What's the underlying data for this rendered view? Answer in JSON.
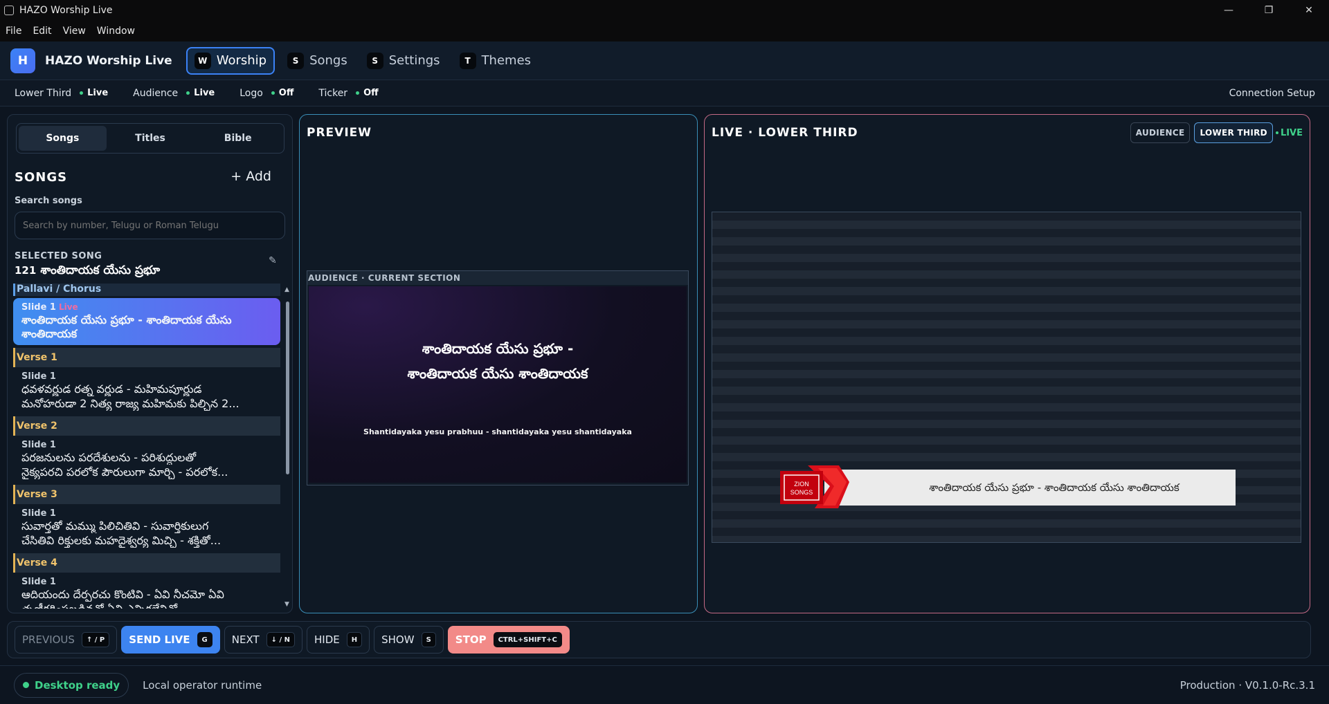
{
  "window": {
    "title": "HAZO Worship Live",
    "controls": [
      "—",
      "❐",
      "✕"
    ]
  },
  "menu": [
    "File",
    "Edit",
    "View",
    "Window"
  ],
  "header": {
    "logo_letter": "H",
    "brand": "HAZO Worship Live",
    "tabs": [
      {
        "key": "W",
        "label": "Worship"
      },
      {
        "key": "S",
        "label": "Songs"
      },
      {
        "key": "S",
        "label": "Settings"
      },
      {
        "key": "T",
        "label": "Themes"
      }
    ]
  },
  "status": {
    "items": [
      {
        "label": "Lower Third",
        "value": "Live",
        "color": "#3fd18a"
      },
      {
        "label": "Audience",
        "value": "Live",
        "color": "#3fd18a"
      },
      {
        "label": "Logo",
        "value": "Off",
        "color": "#3fd18a"
      },
      {
        "label": "Ticker",
        "value": "Off",
        "color": "#3fd18a"
      }
    ],
    "connection": "Connection Setup"
  },
  "left": {
    "segments": [
      "Songs",
      "Titles",
      "Bible"
    ],
    "heading": "SONGS",
    "add_label": "+ Add",
    "search_label": "Search songs",
    "search_placeholder": "Search by number, Telugu or Roman Telugu",
    "selected_label": "SELECTED SONG",
    "selected_number": "121",
    "selected_title": "శాంతిదాయక యేసు ప్రభూ",
    "sections": [
      {
        "name": "Pallavi / Chorus",
        "slide": "Slide 1",
        "live": "Live",
        "text": "శాంతిదాయక యేసు ప్రభూ - శాంతిదాయక యేసు శాంతిదాయక"
      },
      {
        "name": "Verse 1",
        "slide": "Slide 1",
        "line1": "ధవళవర్ణుడ రత్న వర్ణుడ - మహిమపూర్ణుడ",
        "line2": "మనోహరుడా 2 నిత్య రాజ్య మహిమకు పిల్చిన 2..."
      },
      {
        "name": "Verse 2",
        "slide": "Slide 1",
        "line1": "పరజనులను పరదేశులను - పరిశుద్ధులతో",
        "line2": "నైక్యపరచి పరలోక పౌరులుగా మార్చి - పరలోక..."
      },
      {
        "name": "Verse 3",
        "slide": "Slide 1",
        "line1": "సువార్తతో మమ్ము పిలిచితివి - సువార్తికులుగ",
        "line2": "చేసితివి రిక్తులకు మహదైశ్వర్య మిచ్చి - శక్తితో..."
      },
      {
        "name": "Verse 4",
        "slide": "Slide 1",
        "line1": "ఆదియందు దేర్పరచు కొంటివి - ఏవి నీచమో ఏవి",
        "line2": "తృణీకరింపబడినవో ఏవి ఎన్నికలేనివో..."
      }
    ]
  },
  "preview": {
    "heading": "PREVIEW",
    "audience_label": "AUDIENCE · CURRENT SECTION",
    "audience_line1": "శాంతిదాయక యేసు ప్రభూ -",
    "audience_line2": "శాంతిదాయక యేసు శాంతిదాయక",
    "audience_sub": "Shantidayaka yesu prabhuu - shantidayaka yesu shantidayaka"
  },
  "live": {
    "heading": "LIVE · LOWER THIRD",
    "tab_audience": "AUDIENCE",
    "tab_lower_third": "LOWER THIRD",
    "indicator": "LIVE",
    "logo_line1": "ZION",
    "logo_line2": "SONGS",
    "lower_third_text": "శాంతిదాయక యేసు ప్రభూ - శాంతిదాయక యేసు శాంతిదాయక"
  },
  "controls": [
    {
      "label": "PREVIOUS",
      "key": "↑ / P"
    },
    {
      "label": "SEND LIVE",
      "key": "G"
    },
    {
      "label": "NEXT",
      "key": "↓ / N"
    },
    {
      "label": "HIDE",
      "key": "H"
    },
    {
      "label": "SHOW",
      "key": "S"
    },
    {
      "label": "STOP",
      "key": "CTRL+SHIFT+C"
    }
  ],
  "footer": {
    "ready": "Desktop ready",
    "runtime": "Local operator runtime",
    "version": "Production · V0.1.0-Rc.3.1"
  },
  "colors": {
    "accent": "#3b82f6",
    "live_green": "#3fd18a",
    "stop": "#f28a88",
    "preview_border": "#3a8fb8",
    "live_border": "#c46a86"
  }
}
